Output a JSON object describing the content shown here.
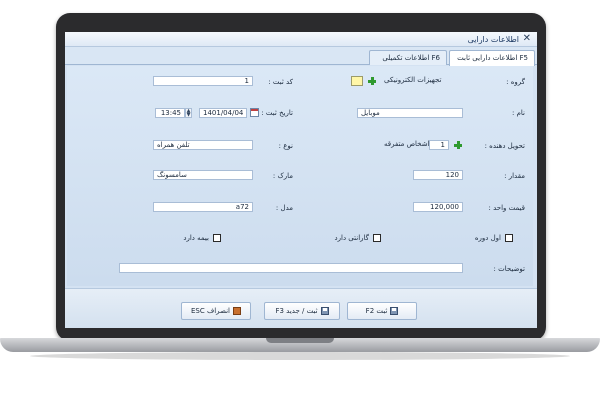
{
  "window": {
    "title": "اطلاعات دارایی",
    "close_glyph": "✕"
  },
  "tabs": [
    {
      "label": "F5 اطلاعات دارایی ثابت",
      "active": true
    },
    {
      "label": "F6 اطلاعات تکمیلی",
      "active": false
    }
  ],
  "form": {
    "group_label": "گروه :",
    "group_value": "تجهیزات الکترونیکی",
    "name_label": "نام :",
    "name_value": "موبایل",
    "delivered_by_label": "تحویل دهنده :",
    "delivered_by_value": "اشخاص متفرقه",
    "delivered_by_code": "1",
    "quantity_label": "مقدار :",
    "quantity_value": "120",
    "unit_price_label": "قیمت واحد :",
    "unit_price_value": "120,000",
    "reg_code_label": "کد ثبت :",
    "reg_code_value": "1",
    "reg_date_label": "تاریخ ثبت :",
    "reg_date_value": "1401/04/04",
    "reg_time_value": "13:45",
    "type_label": "نوع :",
    "type_value": "تلفن همراه",
    "brand_label": "مارک :",
    "brand_value": "سامسونگ",
    "model_label": "مدل :",
    "model_value": "a72",
    "start_of_period_label": "اول دوره",
    "warranty_label": "گارانتی دارد",
    "insurance_label": "بیمه دارد",
    "notes_label": "توضیحات :",
    "notes_value": ""
  },
  "buttons": {
    "save_label": "ثبت F2",
    "save_new_label": "ثبت / جدید F3",
    "cancel_label": "انصراف ESC"
  },
  "colors": {
    "accent_green": "#2f9a2f",
    "panel_blue": "#d4e2f2",
    "highlight_yellow": "#fff7a8"
  }
}
